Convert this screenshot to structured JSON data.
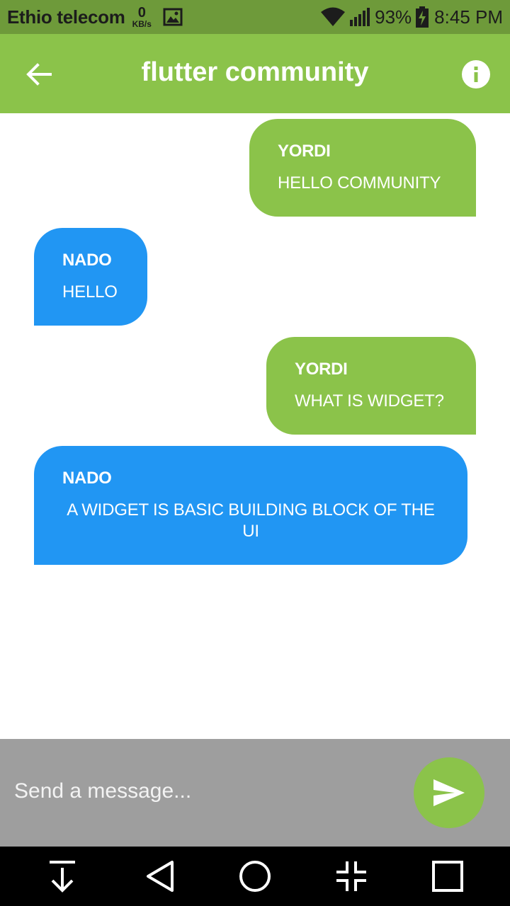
{
  "status_bar": {
    "carrier": "Ethio telecom",
    "data_speed_value": "0",
    "data_speed_unit": "KB/s",
    "battery_percent": "93%",
    "time": "8:45 PM",
    "icons": [
      "image-icon",
      "wifi-icon",
      "signal-icon",
      "battery-charging-icon"
    ]
  },
  "app_bar": {
    "title": "flutter community",
    "back_icon": "arrow-back-icon",
    "info_icon": "info-icon",
    "background": "#8bc34a"
  },
  "messages": [
    {
      "sender": "YORDI",
      "text": "HELLO COMMUNITY",
      "side": "right",
      "color": "#8bc34a"
    },
    {
      "sender": "NADO",
      "text": "HELLO",
      "side": "left",
      "color": "#2196f3"
    },
    {
      "sender": "YORDI",
      "text": "WHAT IS WIDGET?",
      "side": "right",
      "color": "#8bc34a"
    },
    {
      "sender": "NADO",
      "text": "A WIDGET IS BASIC BUILDING BLOCK OF THE UI",
      "side": "left",
      "color": "#2196f3"
    }
  ],
  "composer": {
    "placeholder": "Send a message...",
    "value": "",
    "send_icon": "send-icon",
    "background": "#9e9e9e"
  },
  "nav_bar": {
    "buttons": [
      "notification-down-icon",
      "back-triangle-icon",
      "home-circle-icon",
      "shrink-screen-icon",
      "recents-square-icon"
    ]
  }
}
